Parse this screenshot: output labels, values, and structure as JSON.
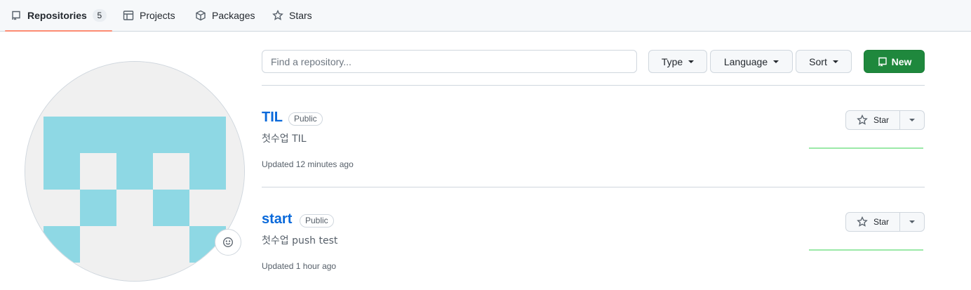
{
  "tabs": [
    {
      "label": "Repositories",
      "count": "5",
      "icon": "repo-icon",
      "selected": true
    },
    {
      "label": "Projects",
      "icon": "table-icon"
    },
    {
      "label": "Packages",
      "icon": "package-icon"
    },
    {
      "label": "Stars",
      "icon": "star-icon"
    }
  ],
  "search": {
    "placeholder": "Find a repository..."
  },
  "filters": {
    "type_label": "Type",
    "language_label": "Language",
    "sort_label": "Sort"
  },
  "new_button": {
    "label": "New"
  },
  "avatar": {
    "primary_color": "#8ed8e4",
    "background_color": "#f0f0f0"
  },
  "colors": {
    "accent_green": "#1f883d",
    "link_blue": "#0969da",
    "tab_underline": "#fd8c73",
    "activity_green": "#9be9a8"
  },
  "repos": [
    {
      "name": "TIL",
      "visibility": "Public",
      "description": "첫수업 TIL",
      "updated": "Updated 12 minutes ago",
      "star_label": "Star"
    },
    {
      "name": "start",
      "visibility": "Public",
      "description": "첫수업 push test",
      "updated": "Updated 1 hour ago",
      "star_label": "Star"
    }
  ]
}
